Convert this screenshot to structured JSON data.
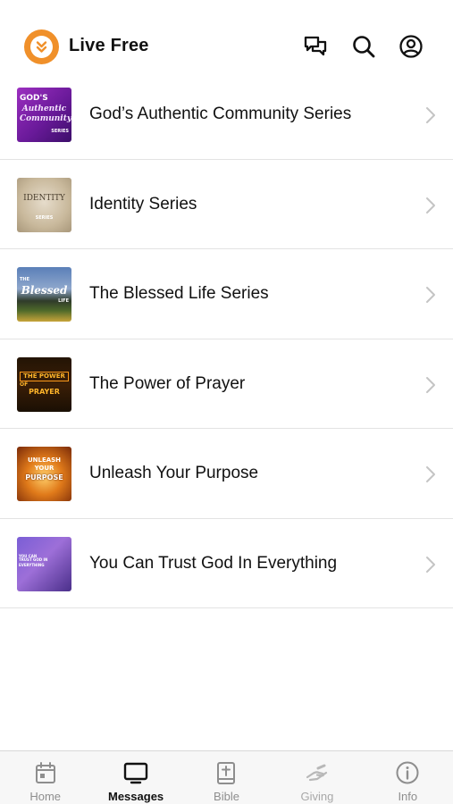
{
  "header": {
    "app_title": "Live Free",
    "icons": [
      "chat-icon",
      "search-icon",
      "profile-icon"
    ],
    "brand_color": "#f0902a"
  },
  "series": [
    {
      "title": "God’s Authentic Community Series",
      "thumb_text": [
        "GOD'S",
        "Authentic",
        "Community",
        "SERIES"
      ]
    },
    {
      "title": "Identity Series",
      "thumb_text": [
        "IDENTITY",
        "SERIES"
      ]
    },
    {
      "title": "The Blessed Life Series",
      "thumb_text": [
        "THE",
        "Blessed",
        "LIFE"
      ]
    },
    {
      "title": "The Power of Prayer",
      "thumb_text": [
        "THE POWER",
        "OF",
        "PRAYER"
      ]
    },
    {
      "title": "Unleash Your Purpose",
      "thumb_text": [
        "UNLEASH",
        "YOUR",
        "PURPOSE"
      ]
    },
    {
      "title": "You Can Trust God In Everything",
      "thumb_text": [
        "YOU CAN TRUST GOD IN",
        "EVERYTHING"
      ]
    }
  ],
  "tabs": [
    {
      "label": "Home",
      "icon": "calendar-icon",
      "active": false
    },
    {
      "label": "Messages",
      "icon": "tv-icon",
      "active": true
    },
    {
      "label": "Bible",
      "icon": "bible-icon",
      "active": false
    },
    {
      "label": "Giving",
      "icon": "giving-hand-icon",
      "active": false
    },
    {
      "label": "Info",
      "icon": "info-icon",
      "active": false
    }
  ],
  "colors": {
    "active_tab": "#111111",
    "inactive_tab": "#8e8e8e",
    "divider": "#e3e3e3"
  }
}
